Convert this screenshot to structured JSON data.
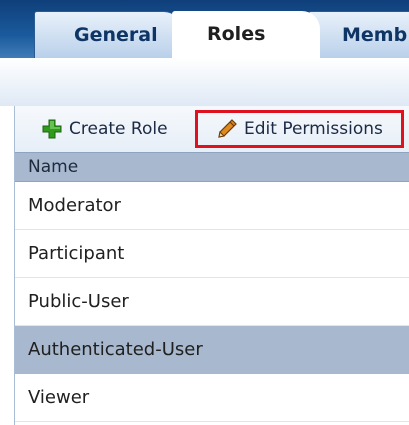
{
  "tabs": {
    "general": "General",
    "roles": "Roles",
    "members": "Memb"
  },
  "toolbar": {
    "create_role": "Create Role",
    "edit_permissions": "Edit Permissions"
  },
  "table": {
    "header": "Name",
    "rows": [
      "Moderator",
      "Participant",
      "Public-User",
      "Authenticated-User",
      "Viewer"
    ],
    "selected": "Authenticated-User"
  },
  "icons": {
    "create": "plus-icon",
    "edit": "pencil-icon"
  },
  "colors": {
    "tab_bar": "#1a5a9c",
    "header_bg": "#a7b8cf",
    "selected_row": "#a7b8cf",
    "highlight_border": "#e0111f",
    "plus_icon": "#2f9a1c"
  }
}
